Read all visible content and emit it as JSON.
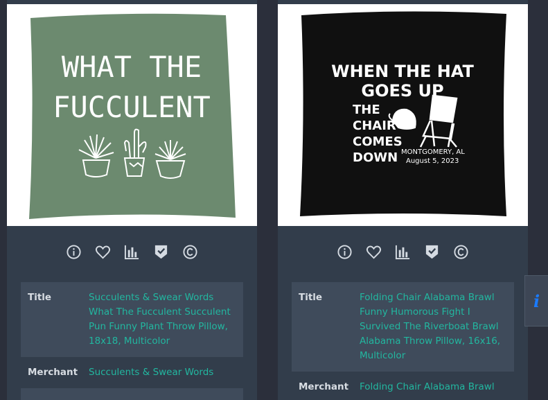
{
  "cards": [
    {
      "image": {
        "lines": [
          "WHAT THE",
          "FUCCULENT"
        ],
        "pillow_color": "#6c8a6f"
      },
      "details": [
        {
          "key": "Title",
          "value": "Succulents & Swear Words What The Fucculent Succulent Pun Funny Plant Throw Pillow, 18x18, Multicolor"
        },
        {
          "key": "Merchant",
          "value": "Succulents & Swear Words"
        }
      ]
    },
    {
      "image": {
        "headline": [
          "WHEN THE HAT",
          "GOES UP"
        ],
        "sub": [
          "THE",
          "CHAIR",
          "COMES",
          "DOWN"
        ],
        "place": "MONTGOMERY, AL",
        "date": "August 5, 2023",
        "pillow_color": "#101010"
      },
      "details": [
        {
          "key": "Title",
          "value": "Folding Chair Alabama Brawl Funny Humorous Fight I Survived The Riverboat Brawl Alabama Throw Pillow, 16x16, Multicolor"
        },
        {
          "key": "Merchant",
          "value": "Folding Chair Alabama Brawl"
        }
      ]
    }
  ],
  "action_icons": [
    "info-icon",
    "heart-icon",
    "bar-chart-icon",
    "shield-check-icon",
    "copyright-icon"
  ],
  "side_info": {
    "label": "i"
  },
  "colors": {
    "accent": "#22b7a0",
    "page_bg": "#2b2f3b",
    "card_bg": "#323d4b",
    "row_shade": "#3f4b5b",
    "info_icon": "#1a7bff"
  }
}
